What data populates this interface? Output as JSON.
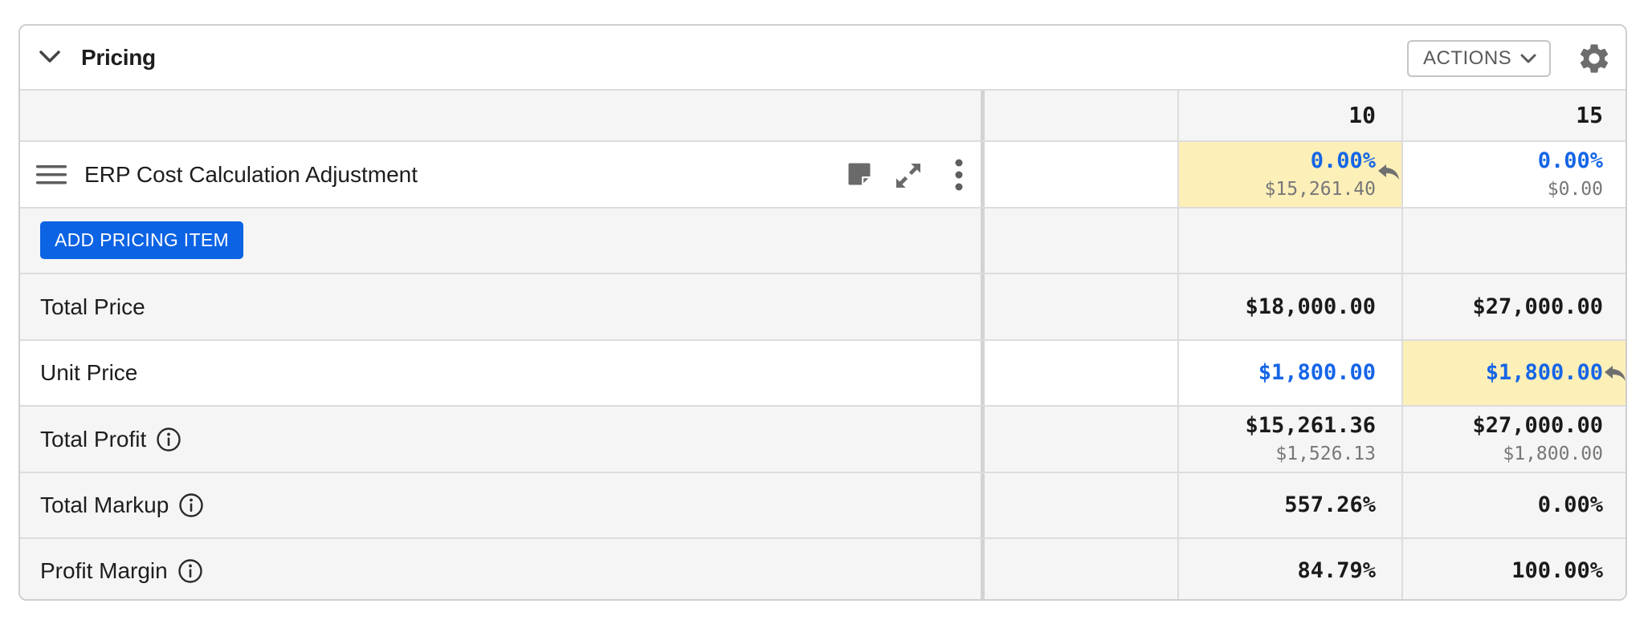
{
  "header": {
    "title": "Pricing",
    "actions_label": "ACTIONS"
  },
  "columns": {
    "blank": "",
    "qty_a": "10",
    "qty_b": "15"
  },
  "item_row": {
    "title": "ERP Cost Calculation Adjustment",
    "qty_a": {
      "value": "0.00%",
      "sub": "$15,261.40"
    },
    "qty_b": {
      "value": "0.00%",
      "sub": "$0.00"
    }
  },
  "add_row": {
    "button_label": "ADD PRICING ITEM"
  },
  "summary_rows": {
    "total_price": {
      "label": "Total Price",
      "qty_a": "$18,000.00",
      "qty_b": "$27,000.00"
    },
    "unit_price": {
      "label": "Unit Price",
      "qty_a": "$1,800.00",
      "qty_b": "$1,800.00"
    },
    "total_profit": {
      "label": "Total Profit",
      "qty_a": "$15,261.36",
      "qty_a_sub": "$1,526.13",
      "qty_b": "$27,000.00",
      "qty_b_sub": "$1,800.00"
    },
    "total_markup": {
      "label": "Total Markup",
      "qty_a": "557.26%",
      "qty_b": "0.00%"
    },
    "profit_margin": {
      "label": "Profit Margin",
      "qty_a": "84.79%",
      "qty_b": "100.00%"
    }
  },
  "colors": {
    "accent_blue": "#1565e6",
    "button_blue": "#0c63e4",
    "highlight": "#fcefb8"
  }
}
